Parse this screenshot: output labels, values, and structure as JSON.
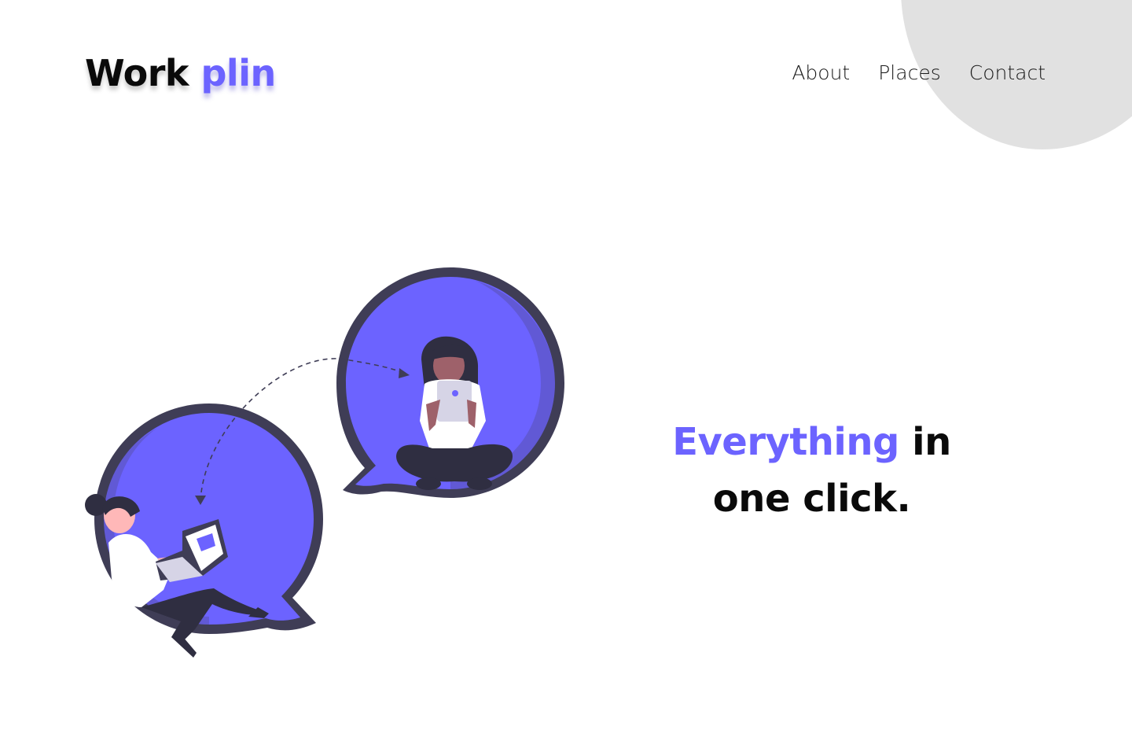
{
  "brand": {
    "name_part1": "Work",
    "name_part2": "plin",
    "accent_color": "#6c63ff"
  },
  "nav": {
    "items": [
      {
        "label": "About"
      },
      {
        "label": "Places"
      },
      {
        "label": "Contact"
      }
    ]
  },
  "hero": {
    "headline_accent": "Everything",
    "headline_rest_line1": "in",
    "headline_line2": "one click."
  },
  "colors": {
    "primary": "#6c63ff",
    "dark": "#3f3d56",
    "text": "#0a0a0a",
    "blob": "#e1e1e1"
  }
}
